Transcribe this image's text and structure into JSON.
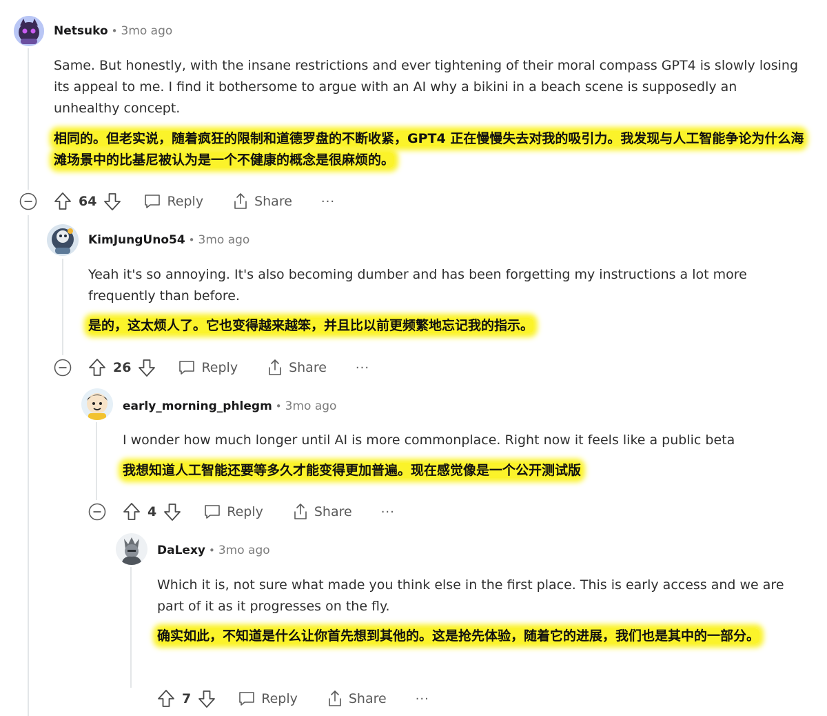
{
  "comments": [
    {
      "author": "Netsuko",
      "time": "3mo ago",
      "body_en": "Same. But honestly, with the insane restrictions and ever tightening of their moral compass GPT4 is slowly losing its appeal to me. I find it bothersome to argue with an AI why a bikini in a beach scene is supposedly an unhealthy concept.",
      "body_zh": "相同的。但老实说，随着疯狂的限制和道德罗盘的不断收紧，GPT4 正在慢慢失去对我的吸引力。我发现与人工智能争论为什么海滩场景中的比基尼被认为是一个不健康的概念是很麻烦的。",
      "score": "64",
      "reply_label": "Reply",
      "share_label": "Share",
      "more_label": "···"
    },
    {
      "author": "KimJungUno54",
      "time": "3mo ago",
      "body_en": "Yeah it's so annoying. It's also becoming dumber and has been forgetting my instructions a lot more frequently than before.",
      "body_zh": "是的，这太烦人了。它也变得越来越笨，并且比以前更频繁地忘记我的指示。",
      "score": "26",
      "reply_label": "Reply",
      "share_label": "Share",
      "more_label": "···"
    },
    {
      "author": "early_morning_phlegm",
      "time": "3mo ago",
      "body_en": "I wonder how much longer until AI is more commonplace. Right now it feels like a public beta",
      "body_zh": "我想知道人工智能还要等多久才能变得更加普遍。现在感觉像是一个公开测试版",
      "score": "4",
      "reply_label": "Reply",
      "share_label": "Share",
      "more_label": "···"
    },
    {
      "author": "DaLexy",
      "time": "3mo ago",
      "body_en": "Which it is, not sure what made you think else in the first place. This is early access and we are part of it as it progresses on the fly.",
      "body_zh": "确实如此，不知道是什么让你首先想到其他的。这是抢先体验，随着它的进展，我们也是其中的一部分。",
      "score": "7",
      "reply_label": "Reply",
      "share_label": "Share",
      "more_label": "···"
    }
  ],
  "separator": "•",
  "icons": {
    "collapse": "collapse-icon",
    "upvote": "upvote-arrow-icon",
    "downvote": "downvote-arrow-icon",
    "reply": "comment-bubble-icon",
    "share": "share-icon",
    "more": "more-horizontal-icon"
  },
  "colors": {
    "highlight": "#fbf32a",
    "meta_gray": "#7c7c7c",
    "thread_line": "#e3e6e8"
  }
}
